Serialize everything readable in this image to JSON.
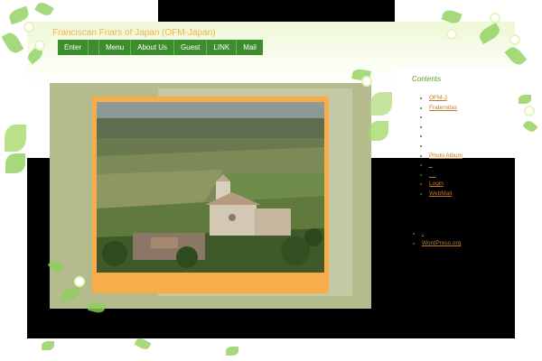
{
  "header": {
    "site_title": "Franciscan Friars of Japan (OFM-Japan)"
  },
  "nav": {
    "items": [
      {
        "label": "Enter"
      },
      {
        "label": ""
      },
      {
        "label": "Menu"
      },
      {
        "label": "About Us"
      },
      {
        "label": "Guest"
      },
      {
        "label": "LINK"
      },
      {
        "label": "Mail"
      }
    ]
  },
  "main": {
    "photo_subject": "Basilica of St. Francis, Assisi, overlooking the valley"
  },
  "sidebar": {
    "heading": "Contents",
    "items": [
      {
        "label": "OFM-J"
      },
      {
        "label": "Fraternitas"
      },
      {
        "label": ""
      },
      {
        "label": ""
      },
      {
        "label": ""
      },
      {
        "label": ""
      },
      {
        "label": "Photo Album"
      },
      {
        "label": "_"
      },
      {
        "label": "__"
      },
      {
        "label": "Login"
      },
      {
        "label": "WebMail"
      }
    ],
    "meta": [
      {
        "label": "."
      },
      {
        "label": "WordPress.org"
      }
    ]
  },
  "colors": {
    "nav_green": "#3d8d2e",
    "photo_frame": "#f8ad4a",
    "link": "#c07a2a",
    "heading": "#5c9e2e"
  },
  "icons": {
    "decor": "green-leaf-and-white-flower"
  }
}
